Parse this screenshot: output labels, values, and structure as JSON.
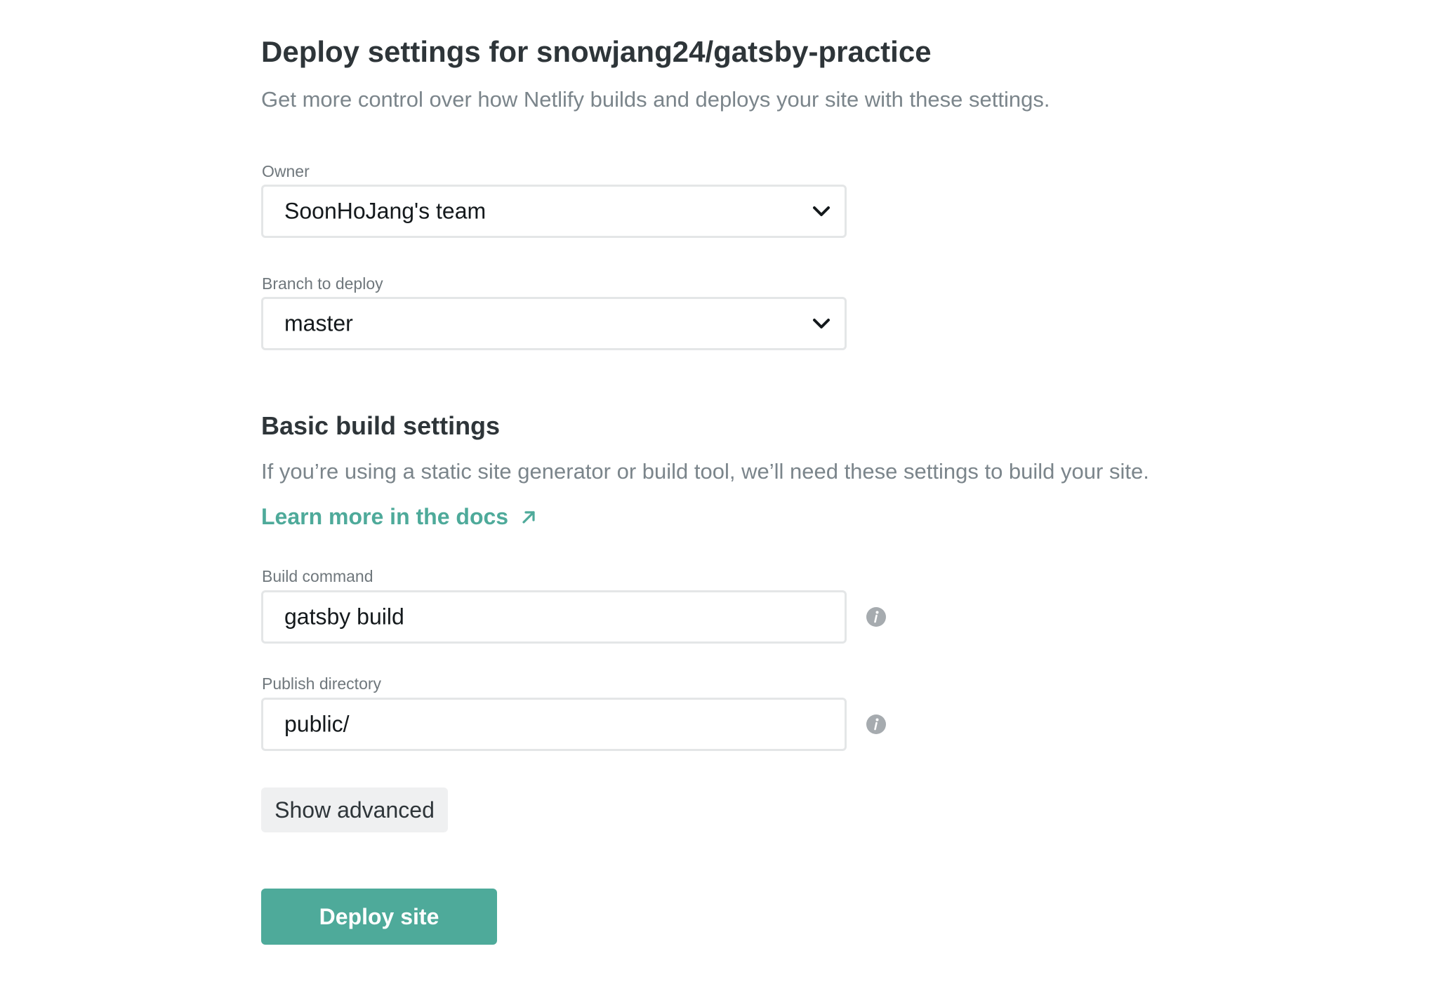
{
  "header": {
    "title": "Deploy settings for snowjang24/gatsby-practice",
    "subtitle": "Get more control over how Netlify builds and deploys your site with these settings."
  },
  "owner": {
    "label": "Owner",
    "value": "SoonHoJang's team",
    "icon": "chevron-down-icon"
  },
  "branch": {
    "label": "Branch to deploy",
    "value": "master",
    "icon": "chevron-down-icon"
  },
  "build_section": {
    "title": "Basic build settings",
    "description": "If you’re using a static site generator or build tool, we’ll need these settings to build your site.",
    "learn_more": "Learn more in the docs",
    "learn_more_icon": "external-arrow-icon"
  },
  "build_command": {
    "label": "Build command",
    "value": "gatsby build",
    "icon": "info-icon"
  },
  "publish_directory": {
    "label": "Publish directory",
    "value": "public/",
    "icon": "info-icon"
  },
  "actions": {
    "show_advanced": "Show advanced",
    "deploy": "Deploy site"
  },
  "colors": {
    "accent": "#4eaa9a",
    "heading": "#2e3539",
    "muted": "#7b858b",
    "border": "#e4e6e7",
    "info_icon": "#a6abaf"
  }
}
